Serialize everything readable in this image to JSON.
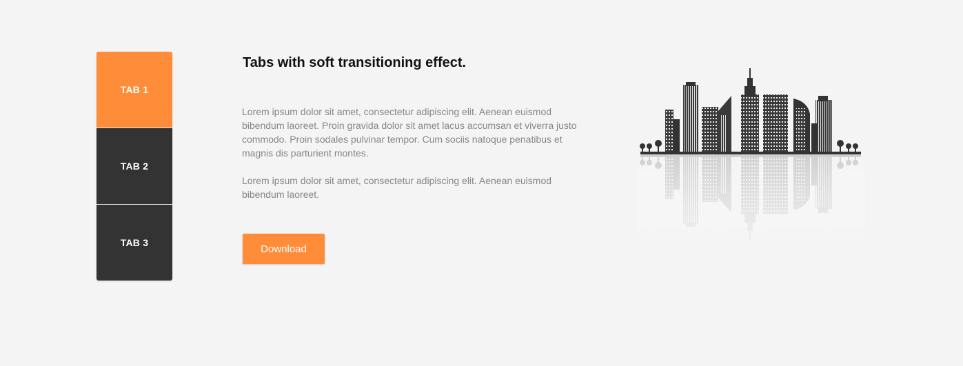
{
  "tabs": [
    {
      "label": "TAB 1",
      "active": true
    },
    {
      "label": "TAB 2",
      "active": false
    },
    {
      "label": "TAB 3",
      "active": false
    }
  ],
  "content": {
    "heading": "Tabs with soft transitioning effect.",
    "paragraph_1": "Lorem ipsum dolor sit amet, consectetur adipiscing elit. Aenean euismod bibendum laoreet. Proin gravida dolor sit amet lacus accumsan et viverra justo commodo. Proin sodales pulvinar tempor. Cum sociis natoque penatibus et magnis dis parturient montes.",
    "paragraph_2": "Lorem ipsum dolor sit amet, consectetur adipiscing elit. Aenean euismod bibendum laoreet.",
    "download_label": "Download"
  },
  "illustration": {
    "icon": "city-skyline-icon"
  },
  "colors": {
    "accent": "#ff8c38",
    "tab_inactive": "#333333",
    "background": "#f4f4f4",
    "heading": "#111111",
    "body_text": "#868686"
  }
}
